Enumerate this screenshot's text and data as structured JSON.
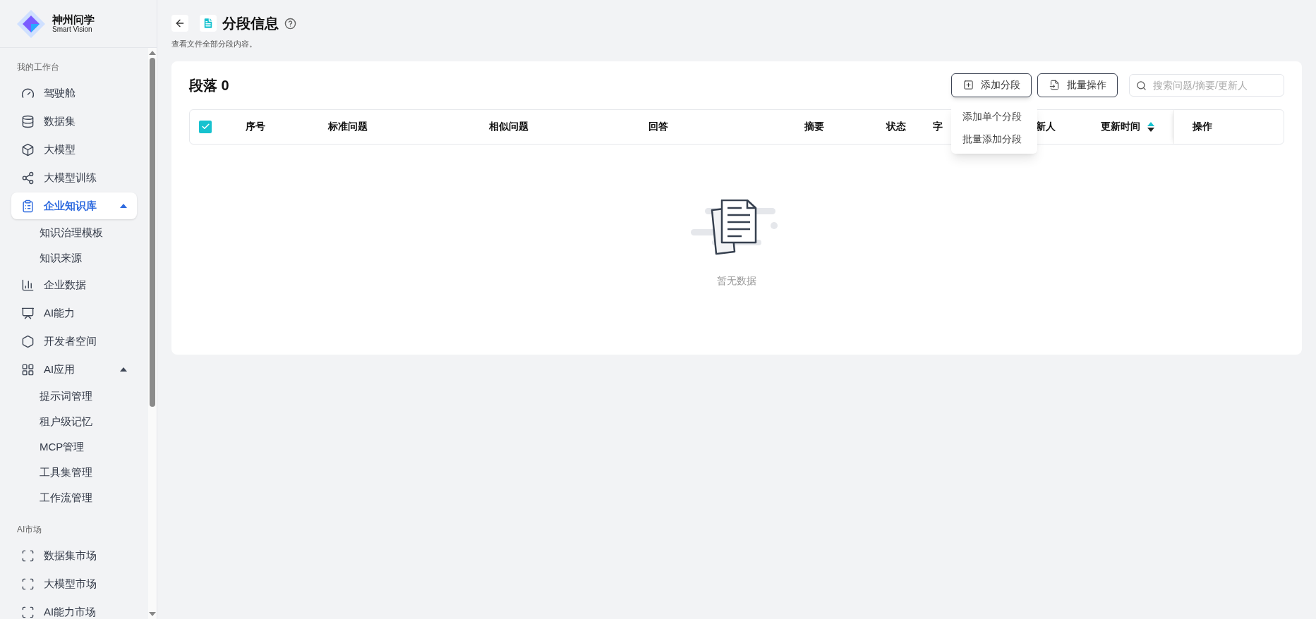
{
  "brand": {
    "name": "神州问学",
    "tagline": "Smart Vision"
  },
  "sidebar": {
    "sections": [
      {
        "label": "我的工作台",
        "items": [
          {
            "label": "驾驶舱",
            "selected": false
          },
          {
            "label": "数据集",
            "selected": false
          },
          {
            "label": "大模型",
            "selected": false
          },
          {
            "label": "大模型训练",
            "selected": false
          },
          {
            "label": "企业知识库",
            "selected": true,
            "expanded": true,
            "children": [
              {
                "label": "知识治理模板",
                "selected": false
              },
              {
                "label": "知识来源",
                "selected": false
              }
            ]
          },
          {
            "label": "企业数据",
            "selected": false
          },
          {
            "label": "AI能力",
            "selected": false
          },
          {
            "label": "开发者空间",
            "selected": false
          },
          {
            "label": "AI应用",
            "selected": false,
            "expanded": true,
            "children": [
              {
                "label": "提示词管理",
                "selected": false
              },
              {
                "label": "租户级记忆",
                "selected": false
              },
              {
                "label": "MCP管理",
                "selected": false
              },
              {
                "label": "工具集管理",
                "selected": false
              },
              {
                "label": "工作流管理",
                "selected": false
              }
            ]
          }
        ]
      },
      {
        "label": "AI市场",
        "items": [
          {
            "label": "数据集市场",
            "selected": false
          },
          {
            "label": "大模型市场",
            "selected": false
          },
          {
            "label": "AI能力市场",
            "selected": false
          }
        ]
      }
    ]
  },
  "page": {
    "title": "分段信息",
    "subtitle": "查看文件全部分段内容。"
  },
  "card": {
    "title": "段落 0",
    "buttons": [
      {
        "label": "添加分段",
        "expanded": true
      },
      {
        "label": "批量操作",
        "expanded": false
      }
    ],
    "add_menu": [
      "添加单个分段",
      "批量添加分段"
    ],
    "search": {
      "placeholder": "搜索问题/摘要/更新人"
    },
    "table": {
      "select_all": {
        "checked": true
      },
      "columns": [
        {
          "label": "序号"
        },
        {
          "label": "标准问题"
        },
        {
          "label": "相似问题"
        },
        {
          "label": "回答"
        },
        {
          "label": "摘要"
        },
        {
          "label": "状态"
        },
        {
          "label": "字"
        },
        {
          "label": "新人"
        },
        {
          "label": "更新时间",
          "sorted_ascending": true
        },
        {
          "label": "操作"
        }
      ],
      "empty_text": "暂无数据"
    }
  }
}
